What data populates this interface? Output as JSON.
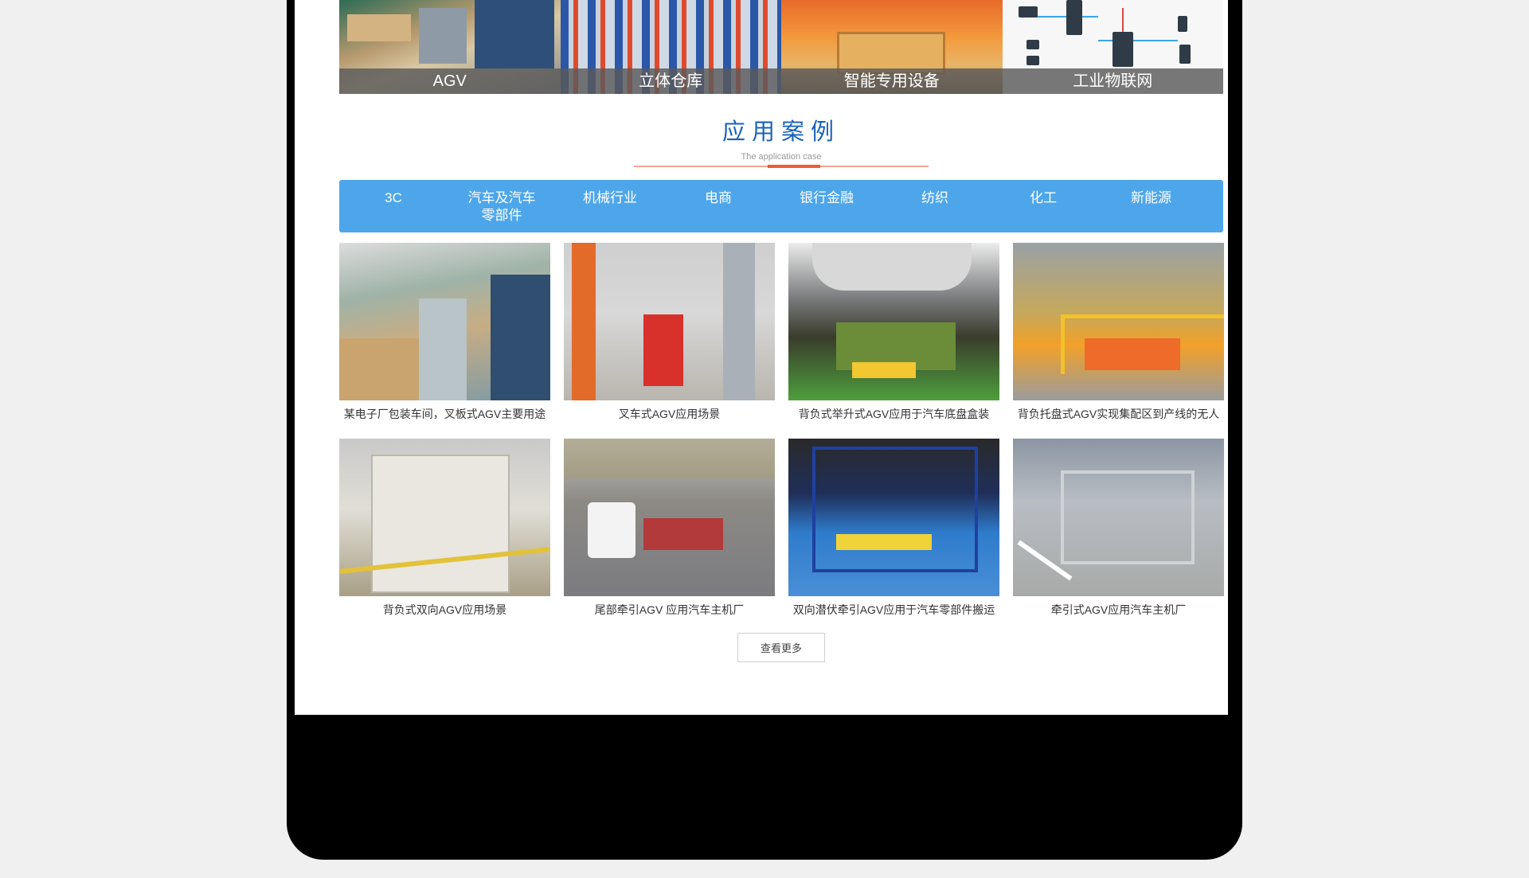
{
  "products": [
    {
      "caption": "AGV"
    },
    {
      "caption": "立体仓库"
    },
    {
      "caption": "智能专用设备"
    },
    {
      "caption": "工业物联网"
    }
  ],
  "section": {
    "title": "应用案例",
    "subtitle": "The application case"
  },
  "tabs": [
    {
      "label": "3C"
    },
    {
      "label": "汽车及汽车零部件"
    },
    {
      "label": "机械行业"
    },
    {
      "label": "电商"
    },
    {
      "label": "银行金融"
    },
    {
      "label": "纺织"
    },
    {
      "label": "化工"
    },
    {
      "label": "新能源"
    }
  ],
  "cases": [
    {
      "title": "某电子厂包装车间，叉板式AGV主要用途"
    },
    {
      "title": "叉车式AGV应用场景"
    },
    {
      "title": "背负式举升式AGV应用于汽车底盘盒装"
    },
    {
      "title": "背负托盘式AGV实现集配区到产线的无人"
    },
    {
      "title": "背负式双向AGV应用场景"
    },
    {
      "title": "尾部牵引AGV 应用汽车主机厂"
    },
    {
      "title": "双向潜伏牵引AGV应用于汽车零部件搬运"
    },
    {
      "title": "牵引式AGV应用汽车主机厂"
    }
  ],
  "more_button": {
    "label": "查看更多"
  }
}
